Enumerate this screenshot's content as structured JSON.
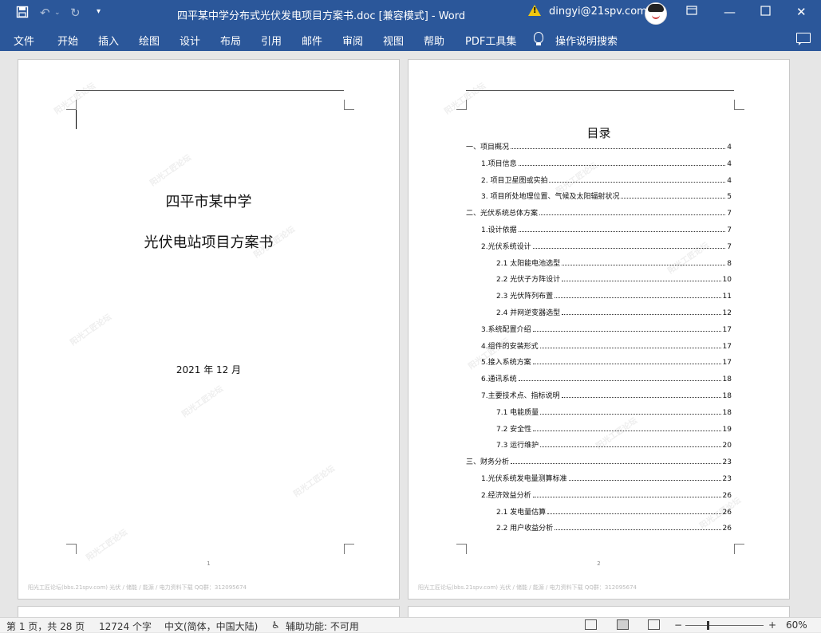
{
  "window": {
    "title": "四平某中学分布式光伏发电项目方案书.doc [兼容模式]  -  Word",
    "user": "dingyi@21spv.com"
  },
  "quick_access": {
    "save_icon": "save-icon",
    "undo_icon": "undo-icon",
    "redo_icon": "redo-icon",
    "customize_icon": "customize-icon"
  },
  "menu": {
    "items": [
      "文件",
      "开始",
      "插入",
      "绘图",
      "设计",
      "布局",
      "引用",
      "邮件",
      "审阅",
      "视图",
      "帮助",
      "PDF工具集"
    ],
    "search": "操作说明搜索"
  },
  "page1": {
    "line1": "四平市某中学",
    "line2": "光伏电站项目方案书",
    "date": "2021 年 12 月",
    "page_number": "1",
    "footer": "阳光工匠论坛(bbs.21spv.com)      光伏 / 储能 / 能源 / 电力资料下载      QQ群：312095674"
  },
  "page2": {
    "toc_title": "目录",
    "page_number": "2",
    "footer": "阳光工匠论坛(bbs.21spv.com)      光伏 / 储能 / 能源 / 电力资料下载      QQ群：312095674",
    "toc": [
      {
        "label": "一、项目概况",
        "page": "4",
        "level": 1
      },
      {
        "label": "1.项目信息",
        "page": "4",
        "level": 2
      },
      {
        "label": "2. 项目卫星图或实拍",
        "page": "4",
        "level": 2
      },
      {
        "label": "3. 项目所处地理位置、气候及太阳辐射状况",
        "page": "5",
        "level": 2
      },
      {
        "label": "二、光伏系统总体方案",
        "page": "7",
        "level": 1
      },
      {
        "label": "1.设计依据",
        "page": "7",
        "level": 2
      },
      {
        "label": "2.光伏系统设计",
        "page": "7",
        "level": 2
      },
      {
        "label": "2.1 太阳能电池选型",
        "page": "8",
        "level": 3
      },
      {
        "label": "2.2 光伏子方阵设计",
        "page": "10",
        "level": 3
      },
      {
        "label": "2.3 光伏阵列布置",
        "page": "11",
        "level": 3
      },
      {
        "label": "2.4 并网逆变器选型",
        "page": "12",
        "level": 3
      },
      {
        "label": "3.系统配置介绍",
        "page": "17",
        "level": 2
      },
      {
        "label": "4.组件的安装形式",
        "page": "17",
        "level": 2
      },
      {
        "label": "5.接入系统方案",
        "page": "17",
        "level": 2
      },
      {
        "label": "6.通讯系统",
        "page": "18",
        "level": 2
      },
      {
        "label": "7.主要技术点、指标说明",
        "page": "18",
        "level": 2
      },
      {
        "label": "7.1 电能质量",
        "page": "18",
        "level": 3
      },
      {
        "label": "7.2 安全性",
        "page": "19",
        "level": 3
      },
      {
        "label": "7.3 运行维护",
        "page": "20",
        "level": 3
      },
      {
        "label": "三、财务分析",
        "page": "23",
        "level": 1
      },
      {
        "label": "1.光伏系统发电量测算标准",
        "page": "23",
        "level": 2
      },
      {
        "label": "2.经济效益分析",
        "page": "26",
        "level": 2
      },
      {
        "label": "2.1 发电量估算",
        "page": "26",
        "level": 3
      },
      {
        "label": "2.2 用户收益分析",
        "page": "26",
        "level": 3
      }
    ]
  },
  "status": {
    "page": "第 1 页，共 28 页",
    "words": "12724 个字",
    "lang": "中文(简体，中国大陆)",
    "accessibility": "辅助功能: 不可用",
    "zoom": "60%",
    "zoom_minus": "−",
    "zoom_plus": "+"
  }
}
